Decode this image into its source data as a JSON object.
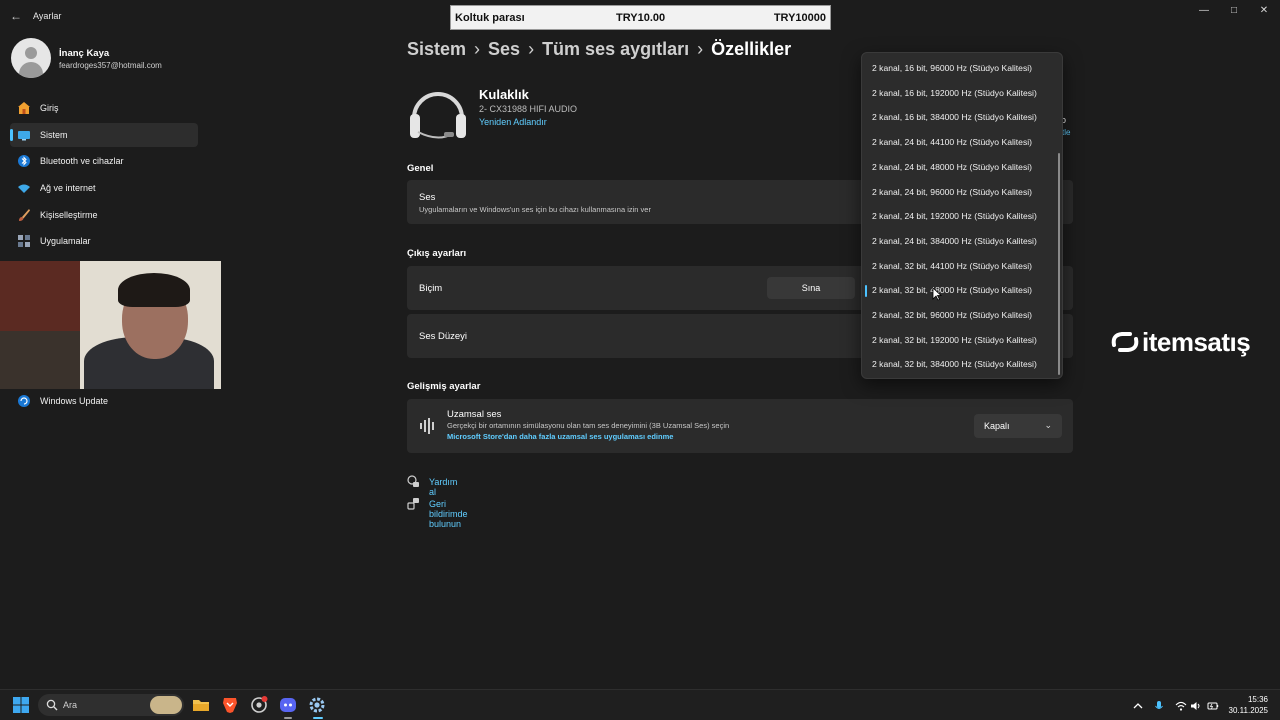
{
  "window": {
    "app_title": "Ayarlar"
  },
  "ticker": {
    "label": "Koltuk parası",
    "price": "TRY10.00",
    "total": "TRY10000"
  },
  "user": {
    "name": "İnanç Kaya",
    "email": "feardroges357@hotmail.com"
  },
  "sidebar": {
    "items": [
      {
        "label": "Giriş",
        "icon": "home-icon"
      },
      {
        "label": "Sistem",
        "icon": "system-icon",
        "active": true
      },
      {
        "label": "Bluetooth ve cihazlar",
        "icon": "bluetooth-icon"
      },
      {
        "label": "Ağ ve internet",
        "icon": "wifi-icon"
      },
      {
        "label": "Kişiselleştirme",
        "icon": "brush-icon"
      },
      {
        "label": "Uygulamalar",
        "icon": "apps-icon"
      }
    ],
    "windows_update": "Windows Update"
  },
  "breadcrumb": {
    "items": [
      "Sistem",
      "Ses",
      "Tüm ses aygıtları"
    ],
    "current": "Özellikler",
    "separator": "›"
  },
  "device": {
    "name": "Kulaklık",
    "model": "2- CX31988 HIFI AUDIO",
    "rename_link": "Yeniden Adlandır",
    "partial_right_a": "o",
    "partial_right_b": "tle"
  },
  "general": {
    "section_title": "Genel",
    "audio_title": "Ses",
    "audio_desc": "Uygulamaların ve Windows'un ses için bu cihazı kullanmasına izin ver"
  },
  "output": {
    "section_title": "Çıkış ayarları",
    "format_label": "Biçim",
    "test_button": "Sına",
    "volume_label": "Ses Düzeyi"
  },
  "advanced": {
    "section_title": "Gelişmiş ayarlar",
    "spatial_title": "Uzamsal ses",
    "spatial_desc": "Gerçekçi bir ortamının simülasyonu olan tam ses deneyimini (3B Uzamsal Ses) seçin",
    "spatial_link": "Microsoft Store'dan daha fazla uzamsal ses uygulaması edinme",
    "spatial_value": "Kapalı"
  },
  "help": {
    "get_help": "Yardım al",
    "feedback": "Geri bildirimde bulunun"
  },
  "format_dropdown": {
    "selected_index": 9,
    "options": [
      "2 kanal, 16 bit, 96000 Hz (Stüdyo Kalitesi)",
      "2 kanal, 16 bit, 192000 Hz (Stüdyo Kalitesi)",
      "2 kanal, 16 bit, 384000 Hz (Stüdyo Kalitesi)",
      "2 kanal, 24 bit, 44100 Hz (Stüdyo Kalitesi)",
      "2 kanal, 24 bit, 48000 Hz (Stüdyo Kalitesi)",
      "2 kanal, 24 bit, 96000 Hz (Stüdyo Kalitesi)",
      "2 kanal, 24 bit, 192000 Hz (Stüdyo Kalitesi)",
      "2 kanal, 24 bit, 384000 Hz (Stüdyo Kalitesi)",
      "2 kanal, 32 bit, 44100 Hz (Stüdyo Kalitesi)",
      "2 kanal, 32 bit, 48000 Hz (Stüdyo Kalitesi)",
      "2 kanal, 32 bit, 96000 Hz (Stüdyo Kalitesi)",
      "2 kanal, 32 bit, 192000 Hz (Stüdyo Kalitesi)",
      "2 kanal, 32 bit, 384000 Hz (Stüdyo Kalitesi)"
    ]
  },
  "watermark": {
    "text": "itemsatış"
  },
  "taskbar": {
    "search_placeholder": "Ara",
    "time": "15:36",
    "date": "30.11.2025"
  },
  "colors": {
    "accent": "#4cc2ff",
    "link": "#60cdff",
    "background": "#1c1c1c",
    "card": "#2b2b2b"
  }
}
